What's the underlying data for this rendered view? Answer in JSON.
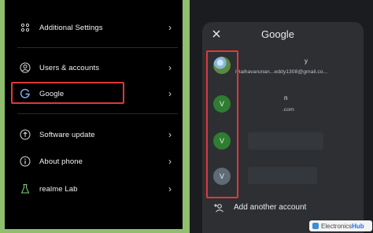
{
  "settings": {
    "items": [
      {
        "label": "Additional Settings",
        "icon": "additional-settings-icon"
      },
      {
        "label": "Users & accounts",
        "icon": "user-icon"
      },
      {
        "label": "Google",
        "icon": "google-icon"
      },
      {
        "label": "Software update",
        "icon": "update-icon"
      },
      {
        "label": "About phone",
        "icon": "info-icon"
      },
      {
        "label": "realme Lab",
        "icon": "flask-icon"
      }
    ],
    "chevron": "›"
  },
  "google_sheet": {
    "title": "Google",
    "close_icon": "close-icon",
    "accounts": [
      {
        "avatar": "",
        "name": "y",
        "email": "iviaihavarunan...eddy1308@gmail.co..."
      },
      {
        "avatar": "V",
        "name": "n",
        "email": ".com"
      },
      {
        "avatar": "V",
        "name": "",
        "email": ""
      },
      {
        "avatar": "V",
        "name": "",
        "email": ""
      }
    ],
    "add_account_label": "Add another account"
  },
  "watermark": {
    "text_a": "Electronics",
    "text_b": "Hub"
  },
  "colors": {
    "highlight": "#e0383b",
    "avatar_green": "#2e7d32",
    "avatar_grey": "#5f6b76"
  }
}
